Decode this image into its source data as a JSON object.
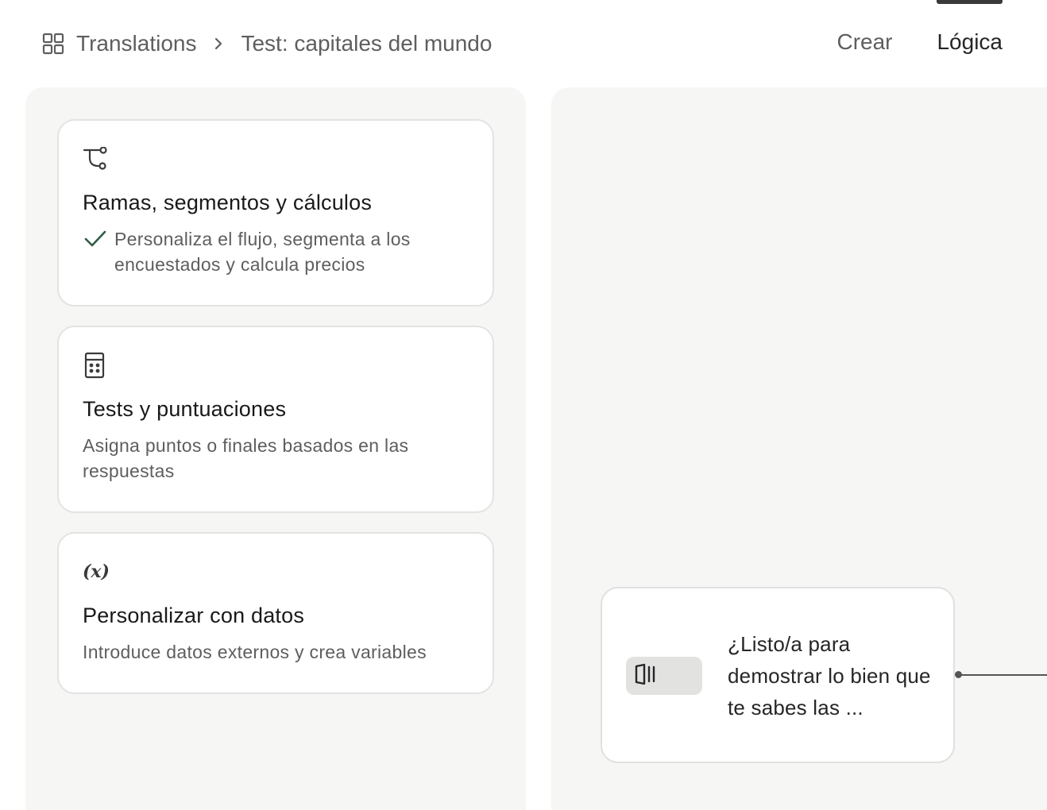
{
  "breadcrumb": {
    "workspace_label": "Translations",
    "current_label": "Test: capitales del mundo"
  },
  "tabs": [
    {
      "label": "Crear",
      "active": false
    },
    {
      "label": "Lógica",
      "active": true
    }
  ],
  "logic_options": [
    {
      "icon": "branch-icon",
      "title": "Ramas, segmentos y cálculos",
      "description": "Personaliza el flujo, segmenta a los encuestados y calcula precios",
      "checked": true
    },
    {
      "icon": "calculator-icon",
      "title": "Tests y puntuaciones",
      "description": "Asigna puntos o finales basados en las respuestas",
      "checked": false
    },
    {
      "icon": "variable-icon",
      "title": "Personalizar con datos",
      "description": "Introduce datos externos y crea variables",
      "checked": false
    }
  ],
  "canvas": {
    "node": {
      "icon": "welcome-screen-icon",
      "text": "¿Listo/a para demostrar lo bien que te sabes las ..."
    }
  },
  "colors": {
    "panel_bg": "#f6f6f5",
    "check_green": "#2f5d46",
    "active_tab_indicator": "#3a3a3a"
  }
}
